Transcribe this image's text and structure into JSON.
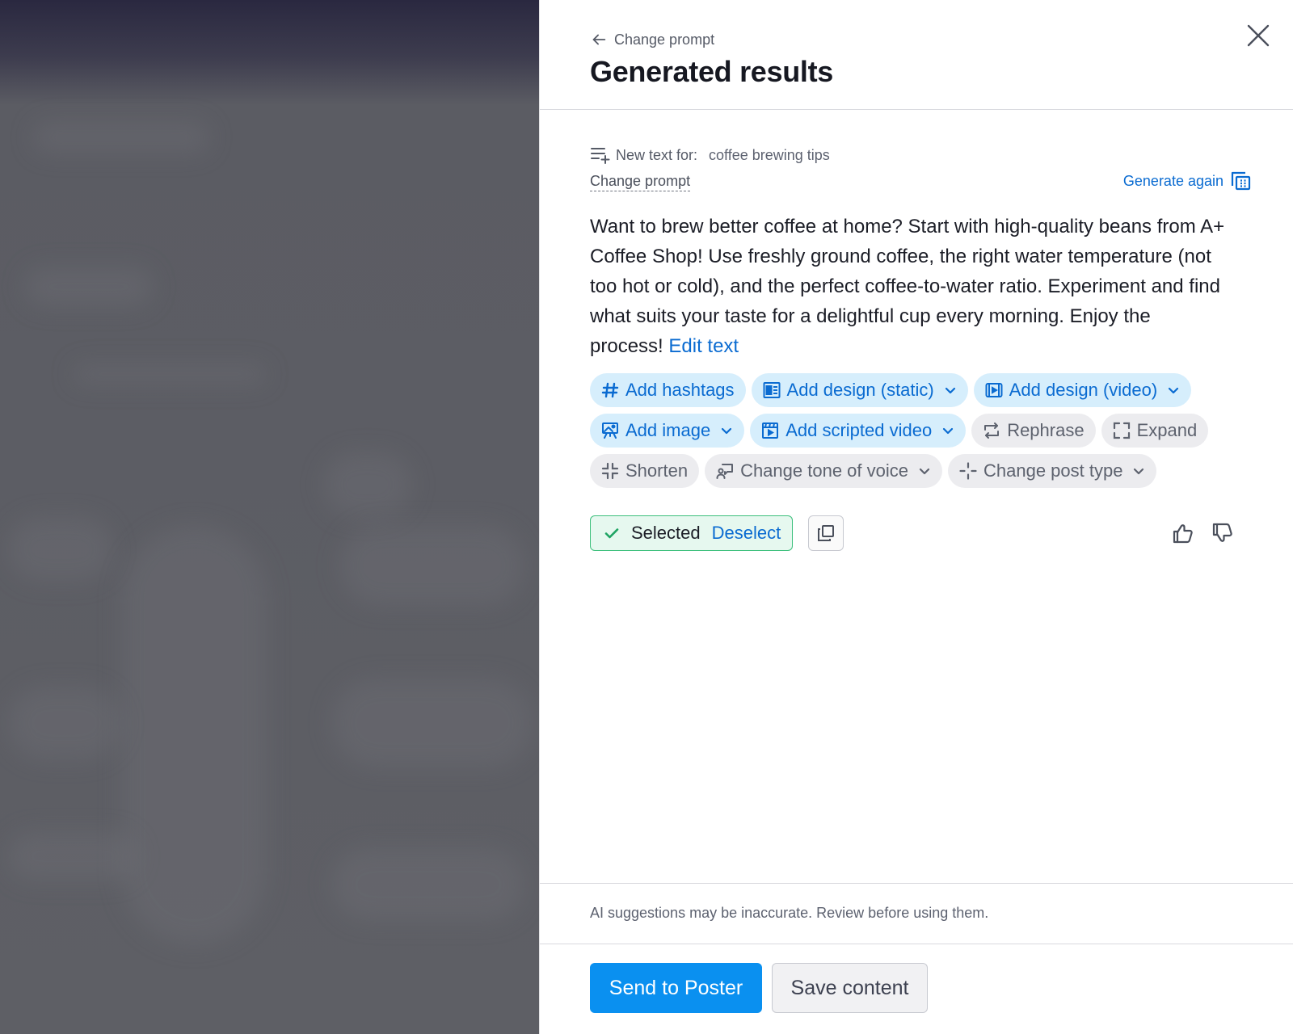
{
  "header": {
    "back_label": "Change prompt",
    "title": "Generated results"
  },
  "prompt": {
    "label": "New text for:",
    "value": "coffee brewing tips",
    "change_label": "Change prompt",
    "generate_again_label": "Generate again"
  },
  "result": {
    "text": "Want to brew better coffee at home? Start with high-quality beans from A+ Coffee Shop! Use freshly ground coffee, the right water temperature (not too hot or cold), and the perfect coffee-to-water ratio. Experiment and find what suits your taste for a delightful cup every morning. Enjoy the process!",
    "edit_label": "Edit text"
  },
  "chips": [
    {
      "label": "Add hashtags",
      "icon": "hashtag-icon",
      "style": "blue",
      "dropdown": false
    },
    {
      "label": "Add design (static)",
      "icon": "design-layout-icon",
      "style": "blue",
      "dropdown": true
    },
    {
      "label": "Add design (video)",
      "icon": "video-design-icon",
      "style": "blue",
      "dropdown": true
    },
    {
      "label": "Add image",
      "icon": "image-easel-icon",
      "style": "blue",
      "dropdown": true
    },
    {
      "label": "Add scripted video",
      "icon": "scripted-video-icon",
      "style": "blue",
      "dropdown": true
    },
    {
      "label": "Rephrase",
      "icon": "rephrase-icon",
      "style": "gray",
      "dropdown": false
    },
    {
      "label": "Expand",
      "icon": "expand-icon",
      "style": "gray",
      "dropdown": false
    },
    {
      "label": "Shorten",
      "icon": "shorten-icon",
      "style": "gray",
      "dropdown": false
    },
    {
      "label": "Change tone of voice",
      "icon": "tone-of-voice-icon",
      "style": "gray",
      "dropdown": true
    },
    {
      "label": "Change post type",
      "icon": "post-type-icon",
      "style": "gray",
      "dropdown": true
    }
  ],
  "selection": {
    "selected_label": "Selected",
    "deselect_label": "Deselect"
  },
  "footer": {
    "disclaimer": "AI suggestions may be inaccurate. Review before using them.",
    "primary_label": "Send to Poster",
    "secondary_label": "Save content"
  },
  "colors": {
    "accent": "#0a6bd1",
    "primary_button": "#0a90f0",
    "chip_blue_bg": "#d6eefc",
    "chip_gray_bg": "#ececef",
    "selected_border": "#3cbf7c",
    "selected_bg": "#e6f8ef"
  }
}
